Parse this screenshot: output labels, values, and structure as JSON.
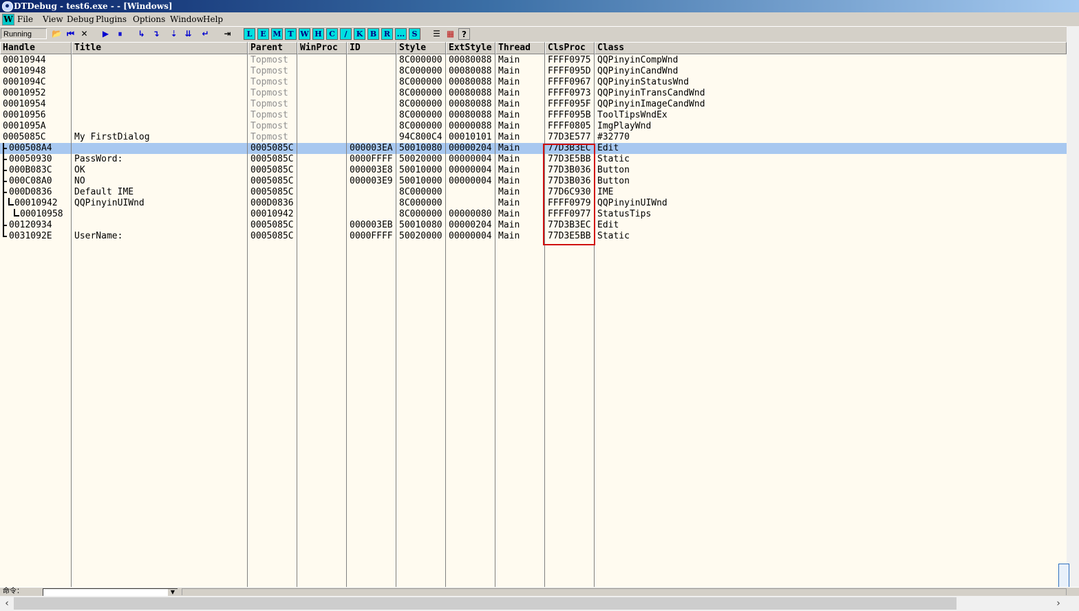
{
  "window": {
    "title": "DTDebug - test6.exe - - [Windows]"
  },
  "menu": {
    "mdi_icon": "W",
    "items": [
      {
        "label": "File"
      },
      {
        "label": "View"
      },
      {
        "label": "Debug"
      },
      {
        "label": "Plugins"
      },
      {
        "label": "Options"
      },
      {
        "label": "Window"
      },
      {
        "label": "Help"
      }
    ]
  },
  "toolbar": {
    "status": "Running",
    "buttons": [
      {
        "name": "open-icon",
        "glyph": "📂"
      },
      {
        "name": "restart-icon",
        "glyph": "⏮"
      },
      {
        "name": "close-icon",
        "glyph": "✕"
      },
      {
        "name": "run-icon",
        "glyph": "▶"
      },
      {
        "name": "pause-icon",
        "glyph": "⏸"
      },
      {
        "name": "step-into-icon",
        "glyph": "↳"
      },
      {
        "name": "step-over-icon",
        "glyph": "↴"
      },
      {
        "name": "trace-into-icon",
        "glyph": "⇣"
      },
      {
        "name": "trace-over-icon",
        "glyph": "⇊"
      },
      {
        "name": "execute-till-return-icon",
        "glyph": "↵"
      },
      {
        "name": "go-to-icon",
        "glyph": "⇥"
      }
    ],
    "windows": [
      "L",
      "E",
      "M",
      "T",
      "W",
      "H",
      "C",
      "/",
      "K",
      "B",
      "R",
      "...",
      "S"
    ],
    "extra": [
      {
        "name": "list-icon",
        "glyph": "☰"
      },
      {
        "name": "grid-icon",
        "glyph": "▦"
      },
      {
        "name": "help-icon",
        "glyph": "?"
      }
    ]
  },
  "table": {
    "columns": [
      "Handle",
      "Title",
      "Parent",
      "WinProc",
      "ID",
      "Style",
      "ExtStyle",
      "Thread",
      "ClsProc",
      "Class"
    ],
    "rows": [
      {
        "handle": "00010944",
        "title": "",
        "parent": "Topmost",
        "winproc": "",
        "id": "",
        "style": "8C000000",
        "extstyle": "00080088",
        "thread": "Main",
        "clsproc": "FFFF0975",
        "class": "QQPinyinCompWnd",
        "depth": 0
      },
      {
        "handle": "00010948",
        "title": "",
        "parent": "Topmost",
        "winproc": "",
        "id": "",
        "style": "8C000000",
        "extstyle": "00080088",
        "thread": "Main",
        "clsproc": "FFFF095D",
        "class": "QQPinyinCandWnd",
        "depth": 0
      },
      {
        "handle": "0001094C",
        "title": "",
        "parent": "Topmost",
        "winproc": "",
        "id": "",
        "style": "8C000000",
        "extstyle": "00080088",
        "thread": "Main",
        "clsproc": "FFFF0967",
        "class": "QQPinyinStatusWnd",
        "depth": 0
      },
      {
        "handle": "00010952",
        "title": "",
        "parent": "Topmost",
        "winproc": "",
        "id": "",
        "style": "8C000000",
        "extstyle": "00080088",
        "thread": "Main",
        "clsproc": "FFFF0973",
        "class": "QQPinyinTransCandWnd",
        "depth": 0
      },
      {
        "handle": "00010954",
        "title": "",
        "parent": "Topmost",
        "winproc": "",
        "id": "",
        "style": "8C000000",
        "extstyle": "00080088",
        "thread": "Main",
        "clsproc": "FFFF095F",
        "class": "QQPinyinImageCandWnd",
        "depth": 0
      },
      {
        "handle": "00010956",
        "title": "",
        "parent": "Topmost",
        "winproc": "",
        "id": "",
        "style": "8C000000",
        "extstyle": "00080088",
        "thread": "Main",
        "clsproc": "FFFF095B",
        "class": "ToolTipsWndEx",
        "depth": 0
      },
      {
        "handle": "0001095A",
        "title": "",
        "parent": "Topmost",
        "winproc": "",
        "id": "",
        "style": "8C000000",
        "extstyle": "00000088",
        "thread": "Main",
        "clsproc": "FFFF0805",
        "class": "ImgPlayWnd",
        "depth": 0
      },
      {
        "handle": "0005085C",
        "title": "My FirstDialog",
        "parent": "Topmost",
        "winproc": "",
        "id": "",
        "style": "94C800C4",
        "extstyle": "00010101",
        "thread": "Main",
        "clsproc": "77D3E577",
        "class": "#32770",
        "depth": 0
      },
      {
        "handle": "000508A4",
        "title": "",
        "parent": "0005085C",
        "winproc": "",
        "id": "000003EA",
        "style": "50010080",
        "extstyle": "00000204",
        "thread": "Main",
        "clsproc": "77D3B3EC",
        "class": "Edit",
        "depth": 1,
        "selected": true
      },
      {
        "handle": "00050930",
        "title": "PassWord:",
        "parent": "0005085C",
        "winproc": "",
        "id": "0000FFFF",
        "style": "50020000",
        "extstyle": "00000004",
        "thread": "Main",
        "clsproc": "77D3E5BB",
        "class": "Static",
        "depth": 1
      },
      {
        "handle": "000B083C",
        "title": "OK",
        "parent": "0005085C",
        "winproc": "",
        "id": "000003E8",
        "style": "50010000",
        "extstyle": "00000004",
        "thread": "Main",
        "clsproc": "77D3B036",
        "class": "Button",
        "depth": 1
      },
      {
        "handle": "000C08A0",
        "title": "NO",
        "parent": "0005085C",
        "winproc": "",
        "id": "000003E9",
        "style": "50010000",
        "extstyle": "00000004",
        "thread": "Main",
        "clsproc": "77D3B036",
        "class": "Button",
        "depth": 1
      },
      {
        "handle": "000D0836",
        "title": "Default IME",
        "parent": "0005085C",
        "winproc": "",
        "id": "",
        "style": "8C000000",
        "extstyle": "",
        "thread": "Main",
        "clsproc": "77D6C930",
        "class": "IME",
        "depth": 1
      },
      {
        "handle": "00010942",
        "title": "QQPinyinUIWnd",
        "parent": "000D0836",
        "winproc": "",
        "id": "",
        "style": "8C000000",
        "extstyle": "",
        "thread": "Main",
        "clsproc": "FFFF0979",
        "class": "QQPinyinUIWnd",
        "depth": 2
      },
      {
        "handle": "00010958",
        "title": "",
        "parent": "00010942",
        "winproc": "",
        "id": "",
        "style": "8C000000",
        "extstyle": "00000080",
        "thread": "Main",
        "clsproc": "FFFF0977",
        "class": "StatusTips",
        "depth": 3
      },
      {
        "handle": "00120934",
        "title": "",
        "parent": "0005085C",
        "winproc": "",
        "id": "000003EB",
        "style": "50010080",
        "extstyle": "00000204",
        "thread": "Main",
        "clsproc": "77D3B3EC",
        "class": "Edit",
        "depth": 1
      },
      {
        "handle": "0031092E",
        "title": "UserName:",
        "parent": "0005085C",
        "winproc": "",
        "id": "0000FFFF",
        "style": "50020000",
        "extstyle": "00000004",
        "thread": "Main",
        "clsproc": "77D3E5BB",
        "class": "Static",
        "depth": 1
      }
    ]
  },
  "command_bar": {
    "label": "命令：",
    "value": ""
  },
  "colors": {
    "accent": "#0a246a",
    "selection": "#a8c8f0",
    "grid_background": "#fffbf0",
    "highlight_box": "#d01010"
  }
}
